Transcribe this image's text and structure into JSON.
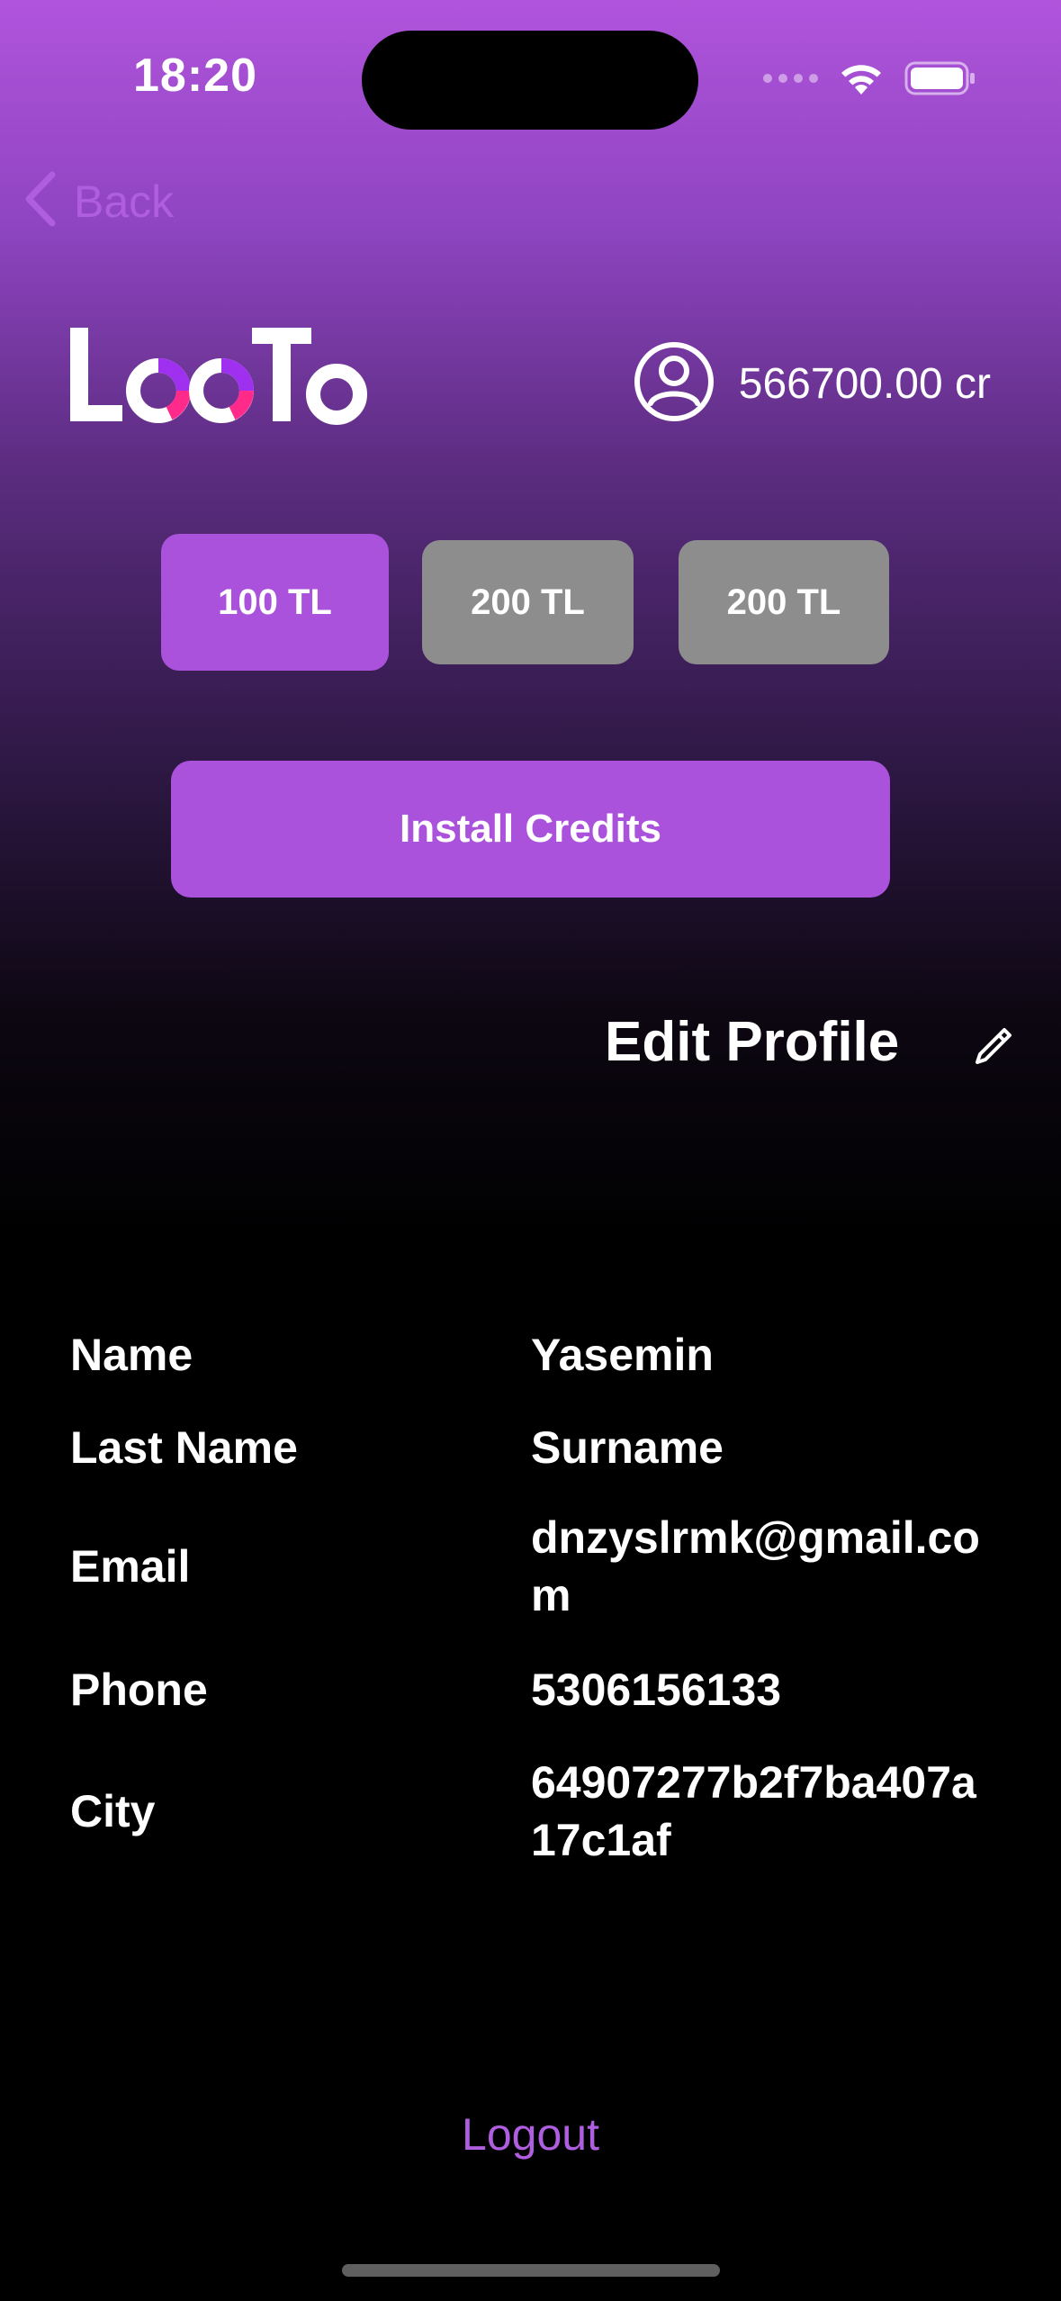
{
  "status_bar": {
    "time": "18:20"
  },
  "nav": {
    "back_label": "Back"
  },
  "header": {
    "logo_text": "LooTo",
    "credits": "566700.00 cr"
  },
  "amounts": [
    {
      "label": "100 TL",
      "selected": true
    },
    {
      "label": "200 TL",
      "selected": false
    },
    {
      "label": "200 TL",
      "selected": false
    }
  ],
  "actions": {
    "install_label": "Install Credits",
    "logout_label": "Logout"
  },
  "profile": {
    "title": "Edit Profile",
    "fields": [
      {
        "label": "Name",
        "value": "Yasemin"
      },
      {
        "label": "Last Name",
        "value": "Surname"
      },
      {
        "label": "Email",
        "value": "dnzyslrmk@gmail.com"
      },
      {
        "label": "Phone",
        "value": "5306156133"
      },
      {
        "label": "City",
        "value": "64907277b2f7ba407a17c1af"
      }
    ]
  },
  "colors": {
    "accent": "#ab52dc",
    "inactive_button": "#8d8d8d",
    "link": "#b05ee0"
  },
  "icons": {
    "back": "chevron-left-icon",
    "account": "account-circle-icon",
    "edit": "pencil-icon",
    "wifi": "wifi-icon",
    "battery": "battery-icon"
  }
}
